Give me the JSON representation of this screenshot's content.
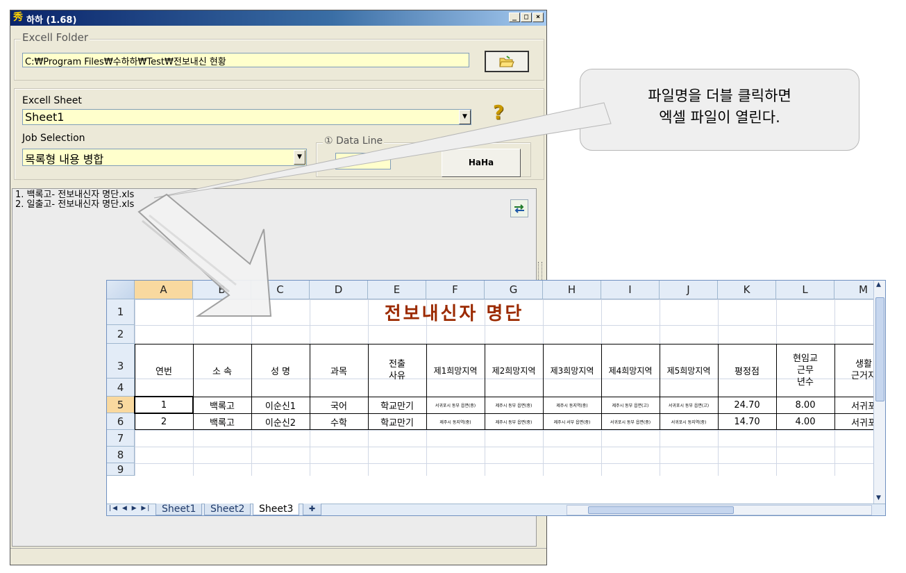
{
  "window": {
    "title": "하하 (1.68)",
    "app_icon": "秀",
    "buttons": [
      "_",
      "□",
      "×"
    ]
  },
  "folder_group": {
    "legend": "Excell Folder",
    "path": "C:₩Program Files₩수하하₩Test₩전보내신 현황"
  },
  "sheet_group": {
    "sheet_label": "Excell Sheet",
    "sheet_value": "Sheet1",
    "job_label": "Job Selection",
    "job_value": "목록형 내용 병합",
    "help_glyph": "?",
    "data_line_legend": "① Data Line",
    "data_line_value": "",
    "run_button": "HaHa"
  },
  "file_list": [
    "1. 백록고- 전보내신자 명단.xls",
    "2. 일출고- 전보내신자 명단.xls"
  ],
  "callout": {
    "line1": "파일명을 더블 클릭하면",
    "line2": "엑셀 파일이 열린다."
  },
  "excel": {
    "columns": [
      "A",
      "B",
      "C",
      "D",
      "E",
      "F",
      "G",
      "H",
      "I",
      "J",
      "K",
      "L",
      "M"
    ],
    "rows": [
      "1",
      "2",
      "3",
      "4",
      "5",
      "6",
      "7",
      "8",
      "9"
    ],
    "sheet_title": "전보내신자 명단",
    "headers": [
      "연번",
      "소  속",
      "성  명",
      "과목",
      "전출\n사유",
      "제1희망지역",
      "제2희망지역",
      "제3희망지역",
      "제4희망지역",
      "제5희망지역",
      "평정점",
      "현임교\n근무\n년수",
      "생활\n근거지"
    ],
    "data_rows": [
      [
        "1",
        "백록고",
        "이순신1",
        "국어",
        "학교만기",
        "서귀포시 동부 읍면(중)",
        "제주시 동부 읍면(중)",
        "제주시 동지역(중)",
        "제주시 동부 읍면(고)",
        "서귀포시 동부 읍면(고)",
        "24.70",
        "8.00",
        "서귀포"
      ],
      [
        "2",
        "백록고",
        "이순신2",
        "수학",
        "학교만기",
        "제주시 동지역(중)",
        "제주시 동부 읍면(중)",
        "제주시 서부 읍면(중)",
        "서귀포시 동부 읍면(중)",
        "서귀포시 동지역(중)",
        "14.70",
        "4.00",
        "서귀포"
      ]
    ],
    "sheet_tabs": [
      "Sheet1",
      "Sheet2",
      "Sheet3"
    ],
    "active_tab": "Sheet3",
    "title_color": "#9b2a00"
  },
  "icons": {
    "folder": "folder-open-icon",
    "refresh": "refresh-icon",
    "help": "help-icon"
  }
}
